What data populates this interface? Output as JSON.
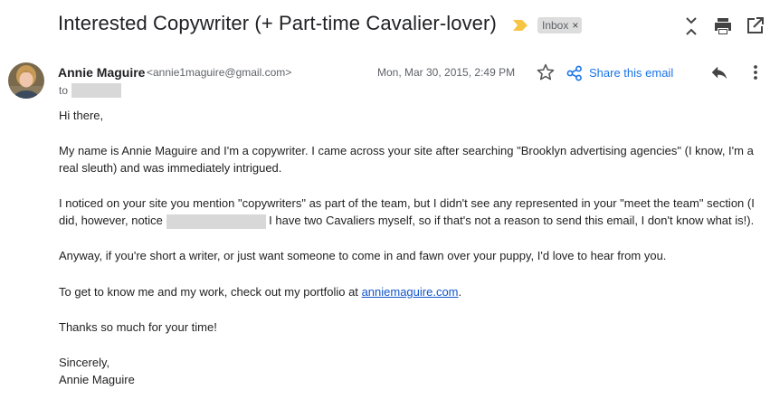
{
  "header": {
    "subject": "Interested Copywriter (+ Part-time Cavalier-lover)",
    "label": "Inbox",
    "label_remove": "×"
  },
  "icons": {
    "important": "important-marker-icon",
    "expand": "expand-icon",
    "print": "print-icon",
    "new_window": "open-new-window-icon",
    "star": "star-icon",
    "share": "share-icon",
    "reply": "reply-icon",
    "more": "more-vert-icon"
  },
  "colors": {
    "important_marker": "#f6c544",
    "share_link": "#1a73e8",
    "link": "#1155cc",
    "redaction": "#d8d8d8"
  },
  "message": {
    "sender_name": "Annie Maguire",
    "sender_email": "<annie1maguire@gmail.com>",
    "to_label": "to",
    "date": "Mon, Mar 30, 2015, 2:49 PM",
    "share_label": "Share this email",
    "body": {
      "greeting": "Hi there,",
      "p1_line1": "My name is Annie Maguire and I'm a copywriter. I came across your site after searching \"Brooklyn advertising agencies\" (I know, I'm a",
      "p1_line2": "real sleuth) and was immediately intrigued.",
      "p2_line1": "I noticed on your site you mention \"copywriters\" as part of the team, but I didn't see any represented in your \"meet the team\" section (I",
      "p2_line2_before": "did, however, notice",
      "p2_line2_after": "I have two Cavaliers myself, so if that's not a reason to send this email, I don't know what is!).",
      "p3": "Anyway, if you're short a writer, or just want someone to come in and fawn over your puppy, I'd love to hear from you.",
      "p4_before": "To get to know me and my work, check out my portfolio at",
      "p4_link": "anniemaguire.com",
      "p4_after": ".",
      "p5": "Thanks so much for your time!",
      "closing": "Sincerely,",
      "signature": "Annie Maguire"
    }
  }
}
